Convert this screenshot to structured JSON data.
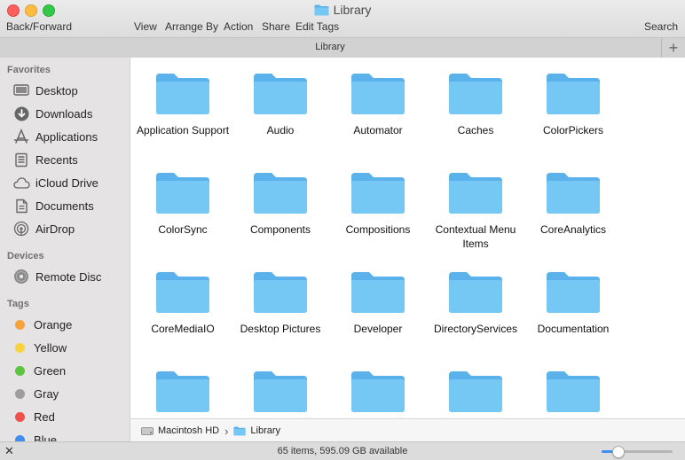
{
  "window": {
    "title": "Library",
    "title_icon": "folder-icon",
    "traffic_lights": {
      "close": "#fc605c",
      "minimize": "#fdbc40",
      "zoom": "#34c84a"
    }
  },
  "toolbar": {
    "back_forward": "Back/Forward",
    "view": "View",
    "arrange_by": "Arrange By",
    "action": "Action",
    "share": "Share",
    "edit_tags": "Edit Tags",
    "search": "Search"
  },
  "tabbar": {
    "title": "Library",
    "add_label": "+"
  },
  "sidebar": {
    "favorites_heading": "Favorites",
    "favorites": [
      {
        "label": "Desktop",
        "icon": "desktop-icon"
      },
      {
        "label": "Downloads",
        "icon": "downloads-icon"
      },
      {
        "label": "Applications",
        "icon": "applications-icon"
      },
      {
        "label": "Recents",
        "icon": "recents-icon"
      },
      {
        "label": "iCloud Drive",
        "icon": "cloud-icon"
      },
      {
        "label": "Documents",
        "icon": "documents-icon"
      },
      {
        "label": "AirDrop",
        "icon": "airdrop-icon"
      }
    ],
    "devices_heading": "Devices",
    "devices": [
      {
        "label": "Remote Disc",
        "icon": "disc-icon"
      }
    ],
    "tags_heading": "Tags",
    "tags": [
      {
        "label": "Orange",
        "color": "#f5a33a"
      },
      {
        "label": "Yellow",
        "color": "#f7d23e"
      },
      {
        "label": "Green",
        "color": "#5cc43e"
      },
      {
        "label": "Gray",
        "color": "#9e9e9e"
      },
      {
        "label": "Red",
        "color": "#f0504a"
      },
      {
        "label": "Blue",
        "color": "#3f8df0"
      }
    ]
  },
  "folders": [
    {
      "name": "Application Support"
    },
    {
      "name": "Audio"
    },
    {
      "name": "Automator"
    },
    {
      "name": "Caches"
    },
    {
      "name": "ColorPickers"
    },
    {
      "name": "ColorSync"
    },
    {
      "name": "Components"
    },
    {
      "name": "Compositions"
    },
    {
      "name": "Contextual Menu Items"
    },
    {
      "name": "CoreAnalytics"
    },
    {
      "name": "CoreMediaIO"
    },
    {
      "name": "Desktop Pictures"
    },
    {
      "name": "Developer"
    },
    {
      "name": "DirectoryServices"
    },
    {
      "name": "Documentation"
    },
    {
      "name": ""
    },
    {
      "name": ""
    },
    {
      "name": ""
    },
    {
      "name": ""
    },
    {
      "name": ""
    }
  ],
  "pathbar": {
    "items": [
      {
        "label": "Macintosh HD",
        "icon": "hard-drive-icon"
      },
      {
        "label": "Library",
        "icon": "folder-icon"
      }
    ],
    "separator": "›"
  },
  "statusbar": {
    "status": "65 items, 595.09 GB available",
    "icon_size_level": 0.22
  },
  "colors": {
    "folder_front": "#75c7f4",
    "folder_back": "#5bb2ea",
    "accent": "#3d8ef7"
  }
}
